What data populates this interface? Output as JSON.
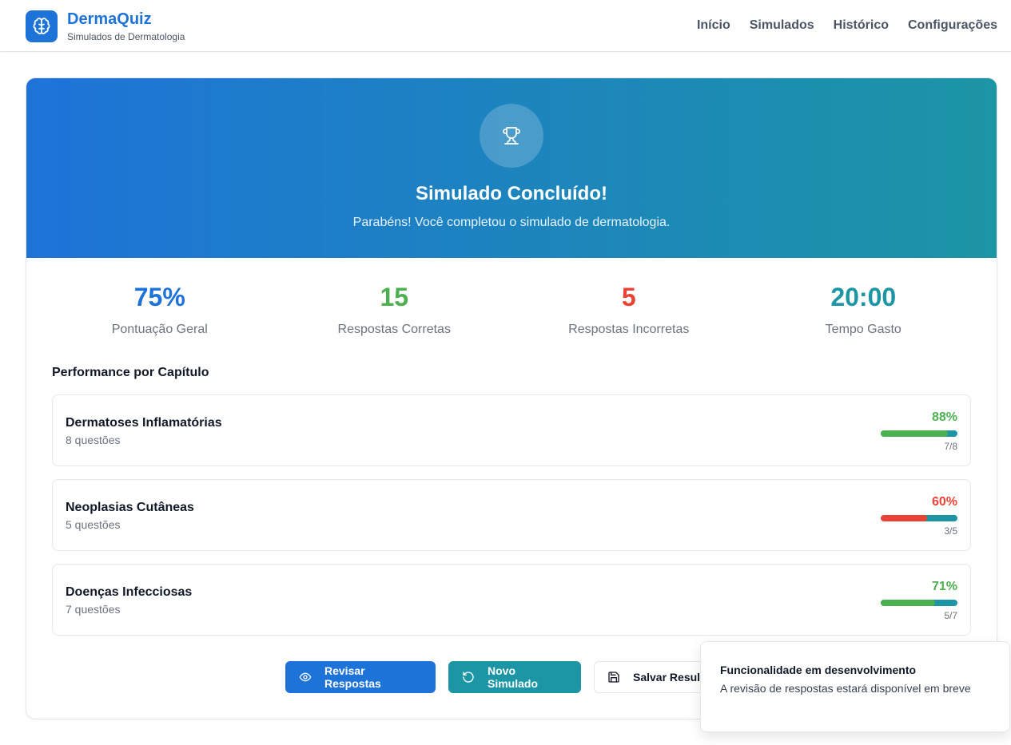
{
  "header": {
    "brand_title": "DermaQuiz",
    "brand_subtitle": "Simulados de Dermatologia",
    "nav": [
      "Início",
      "Simulados",
      "Histórico",
      "Configurações"
    ],
    "icons": {
      "logo": "brain-icon"
    }
  },
  "hero": {
    "icon": "trophy-icon",
    "title": "Simulado Concluído!",
    "subtitle": "Parabéns! Você completou o simulado de dermatologia."
  },
  "stats": [
    {
      "value": "75%",
      "label": "Pontuação Geral",
      "color": "#1e73d8"
    },
    {
      "value": "15",
      "label": "Respostas Corretas",
      "color": "#4caf50"
    },
    {
      "value": "5",
      "label": "Respostas Incorretas",
      "color": "#ea4335"
    },
    {
      "value": "20:00",
      "label": "Tempo Gasto",
      "color": "#1c95a5"
    }
  ],
  "performance": {
    "title": "Performance por Capítulo",
    "chapters": [
      {
        "name": "Dermatoses Inflamatórias",
        "count": "8 questões",
        "percent": "88%",
        "fraction": "7/8",
        "fill": 0.88,
        "color": "#4caf50"
      },
      {
        "name": "Neoplasias Cutâneas",
        "count": "5 questões",
        "percent": "60%",
        "fraction": "3/5",
        "fill": 0.6,
        "color": "#ea4335"
      },
      {
        "name": "Doenças Infecciosas",
        "count": "7 questões",
        "percent": "71%",
        "fraction": "5/7",
        "fill": 0.71,
        "color": "#4caf50"
      }
    ]
  },
  "actions": {
    "review_label": "Revisar Respostas",
    "new_label": "Novo Simulado",
    "save_label": "Salvar Resultado"
  },
  "toast": {
    "title": "Funcionalidade em desenvolvimento",
    "message": "A revisão de respostas estará disponível em breve"
  },
  "colors": {
    "primary": "#1e73d8",
    "teal": "#1c95a5",
    "success": "#4caf50",
    "danger": "#ea4335"
  }
}
